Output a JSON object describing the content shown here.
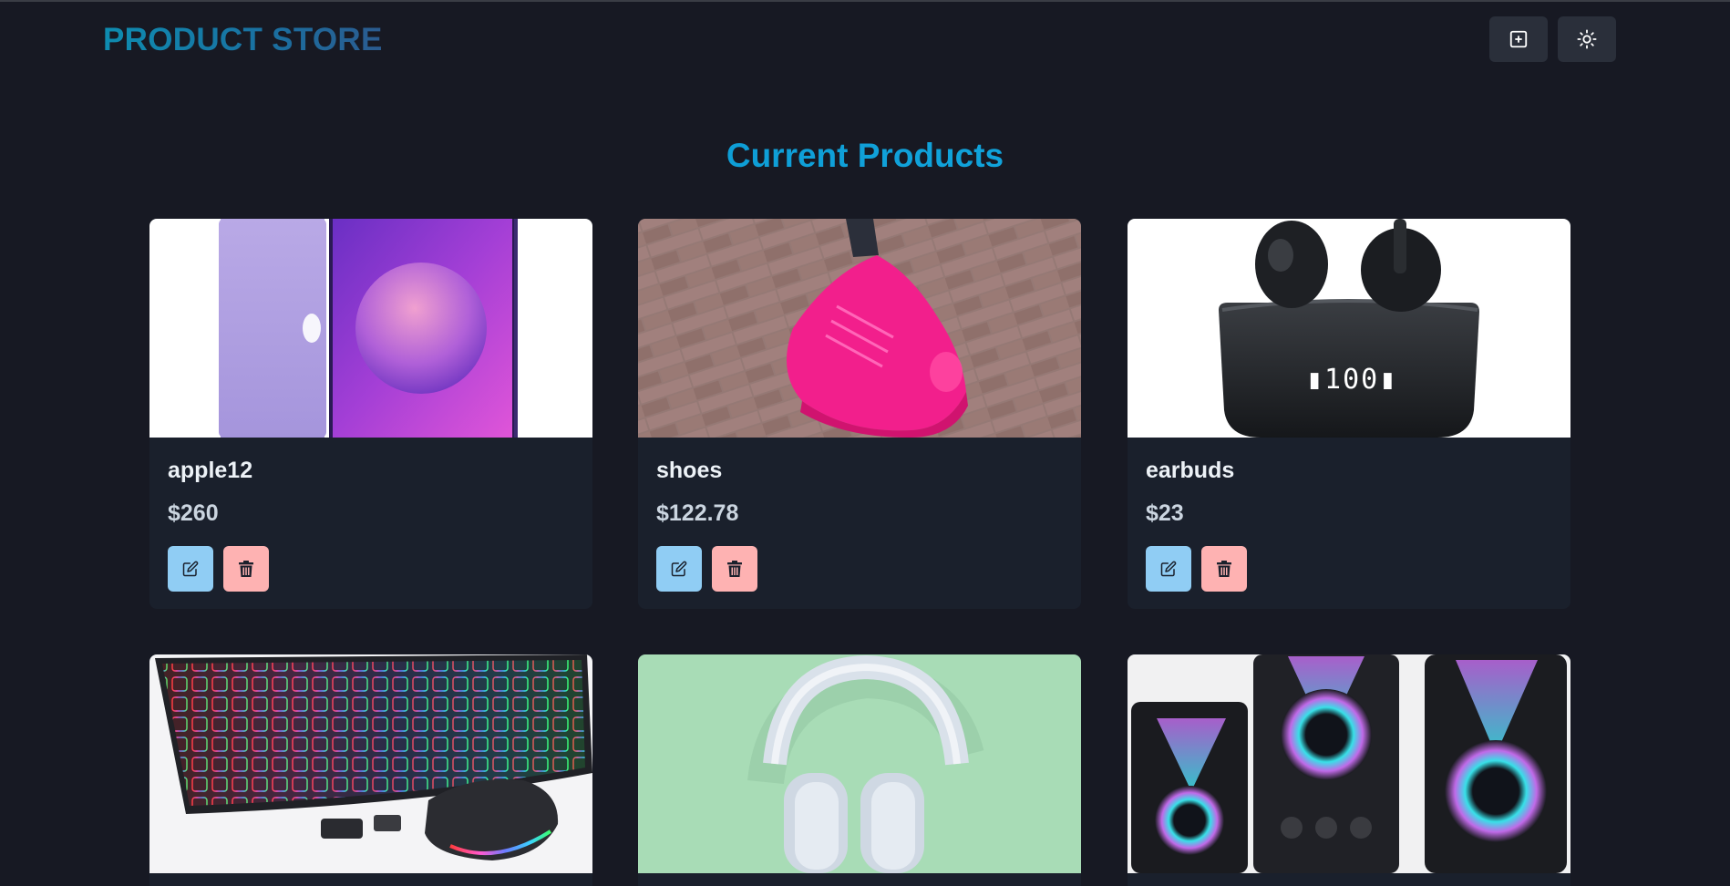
{
  "header": {
    "brand": "PRODUCT STORE",
    "add_button_icon": "plus-square-icon",
    "theme_button_icon": "sun-icon"
  },
  "main": {
    "title": "Current Products",
    "products": [
      {
        "name": "apple12",
        "price": "$260",
        "image": "purple-iphone-12-image"
      },
      {
        "name": "shoes",
        "price": "$122.78",
        "image": "pink-sneakers-image"
      },
      {
        "name": "earbuds",
        "price": "$23",
        "image": "black-wireless-earbuds-image"
      },
      {
        "name": "",
        "price": "",
        "image": "rgb-keyboard-mouse-image"
      },
      {
        "name": "",
        "price": "",
        "image": "white-headphones-image"
      },
      {
        "name": "",
        "price": "",
        "image": "rgb-speakers-image"
      }
    ]
  },
  "colors": {
    "background": "#171923",
    "card": "#1a202c",
    "edit_button": "#90cdf4",
    "delete_button": "#feb2b2",
    "accent": "#0ea5e9"
  }
}
